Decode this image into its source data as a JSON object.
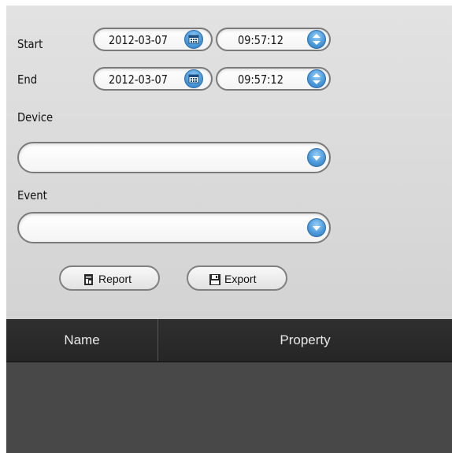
{
  "filters": {
    "start": {
      "label": "Start",
      "date": "2012-03-07",
      "time": "09:57:12"
    },
    "end": {
      "label": "End",
      "date": "2012-03-07",
      "time": "09:57:12"
    },
    "device": {
      "label": "Device",
      "value": ""
    },
    "event": {
      "label": "Event",
      "value": ""
    }
  },
  "buttons": {
    "report": "Report",
    "export": "Export"
  },
  "table": {
    "columns": [
      "Name",
      "Property"
    ]
  },
  "colors": {
    "accent": "#4d9bdc",
    "header_bg": "#2b2b2b",
    "body_bg": "#484848"
  }
}
